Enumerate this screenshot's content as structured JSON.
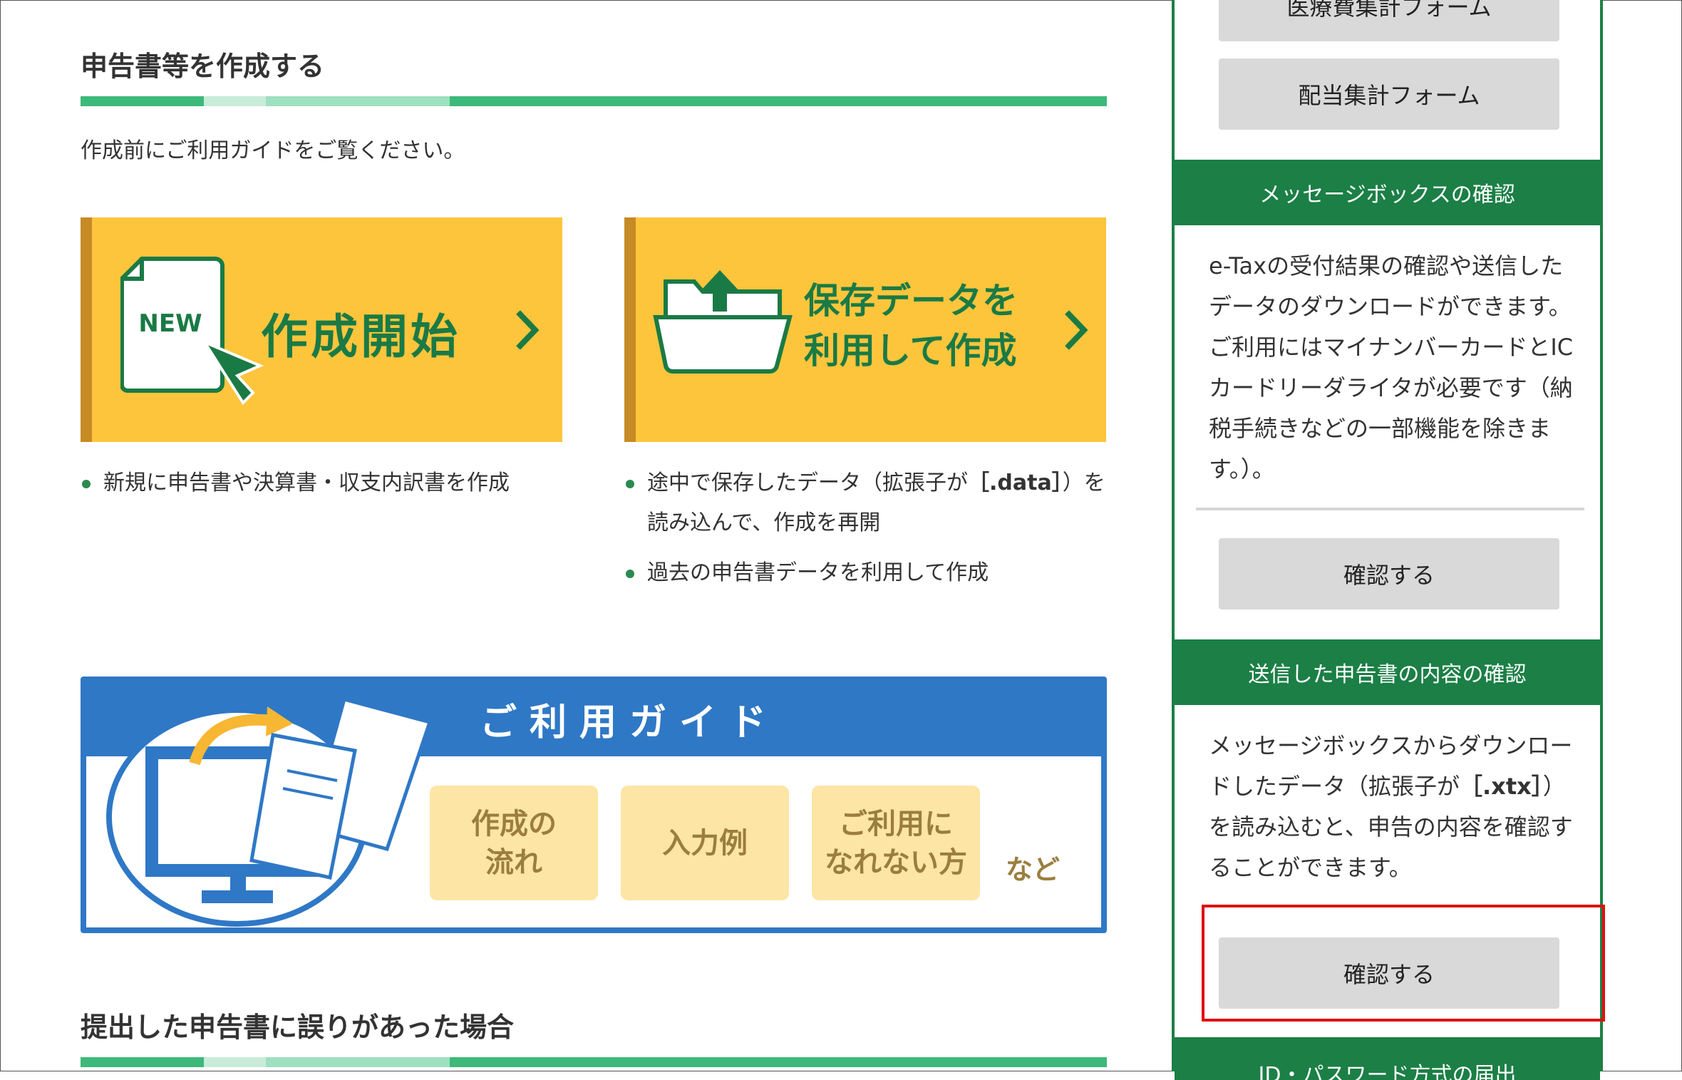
{
  "sections": {
    "create_title": "申告書等を作成する",
    "create_intro": "作成前にご利用ガイドをご覧ください。",
    "error_title": "提出した申告書に誤りがあった場合"
  },
  "cards": {
    "new": {
      "badge": "NEW",
      "title": "作成開始"
    },
    "saved": {
      "title_line1": "保存データを",
      "title_line2": "利用して作成"
    }
  },
  "bullets": {
    "new_item": "新規に申告書や決算書・収支内訳書を作成",
    "saved_item1_pre": "途中で保存したデータ（拡張子が",
    "saved_item1_ext": "［.data］",
    "saved_item1_post": "）を読み込んで、作成を再開",
    "saved_item2": "過去の申告書データを利用して作成"
  },
  "guide": {
    "title": "ご利用ガイド",
    "tile1_line1": "作成の",
    "tile1_line2": "流れ",
    "tile2": "入力例",
    "tile3_line1": "ご利用に",
    "tile3_line2": "なれない方",
    "etc": "など"
  },
  "sidebar": {
    "btn_medical": "医療費集計フォーム",
    "btn_dividend": "配当集計フォーム",
    "msgbox_heading": "メッセージボックスの確認",
    "msgbox_text": "e-Taxの受付結果の確認や送信したデータのダウンロードができます。ご利用にはマイナンバーカードとICカードリーダライタが必要です（納税手続きなどの一部機能を除きます。）。",
    "msgbox_button": "確認する",
    "sent_heading": "送信した申告書の内容の確認",
    "sent_text_pre": "メッセージボックスからダウンロードしたデータ（拡張子が",
    "sent_text_ext": "［.xtx］",
    "sent_text_post": "）を読み込むと、申告の内容を確認することができます。",
    "sent_button": "確認する",
    "id_heading": "ID・パスワード方式の届出"
  },
  "colors": {
    "green_dark": "#1b7f46",
    "green_text": "#1a7a45",
    "card_yellow": "#fdc53c",
    "guide_blue": "#2f78c6",
    "highlight_red": "#e01010"
  }
}
